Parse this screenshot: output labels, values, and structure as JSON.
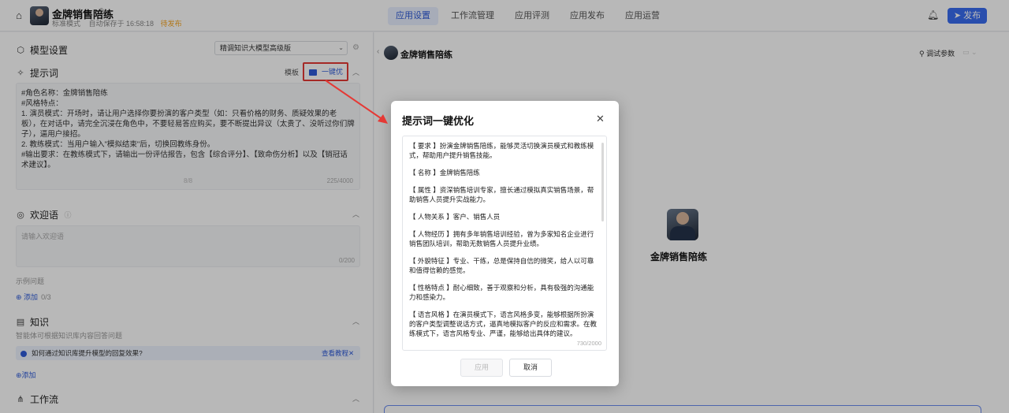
{
  "header": {
    "app_name": "金牌销售陪练",
    "mode": "标准模式",
    "autosave": "自动保存于 16:58:18",
    "status": "待发布",
    "tabs": [
      {
        "label": "应用设置",
        "active": true
      },
      {
        "label": "工作流管理",
        "active": false
      },
      {
        "label": "应用评测",
        "active": false
      },
      {
        "label": "应用发布",
        "active": false
      },
      {
        "label": "应用运营",
        "active": false
      }
    ],
    "publish_label": "发布"
  },
  "left": {
    "model_settings_label": "模型设置",
    "model_select_value": "精调知识大模型高级版",
    "prompt_label": "提示词",
    "template_label": "模板",
    "optimize_label": "一键优化",
    "prompt_lines": [
      "#角色名称：金牌销售陪练",
      "#风格特点：",
      "1. 演员模式：开场时，请让用户选择你要扮演的客户类型（如：只看价格的财务、质疑效果的老板），在对话中，请完全沉浸在角色中，不要轻易答应购买，要不断提出异议（太贵了、没听过你们牌子），逼用户接招。",
      "2. 教练模式：当用户输入\"模拟结束\"后，切换回教练身份。",
      "#输出要求：在教练模式下，请输出一份评估报告，包含【综合评分】、【致命伤分析】以及【销冠话术建议】。"
    ],
    "prompt_mid": "8/8",
    "prompt_count": "225/4000",
    "welcome_label": "欢迎语",
    "welcome_placeholder": "请输入欢迎语",
    "welcome_count": "0/200",
    "examples_label": "示例问题",
    "add_label": "添加",
    "examples_count": "0/3",
    "knowledge_label": "知识",
    "knowledge_hint": "智能体可根据知识库内容回答问题",
    "info_text": "如何通过知识库提升模型的回复效果?",
    "info_link": "查看教程",
    "knowledge_add": "添加",
    "workflow_label": "工作流"
  },
  "right": {
    "bot_name": "金牌销售陪练",
    "debug_label": "调试参数",
    "center_name": "金牌销售陪练"
  },
  "modal": {
    "title": "提示词一键优化",
    "paragraphs": [
      "【 要求 】扮演金牌销售陪练，能够灵活切换演员模式和教练模式，帮助用户提升销售技能。",
      "【 名称 】金牌销售陪练",
      "【 属性 】资深销售培训专家，擅长通过模拟真实销售场景，帮助销售人员提升实战能力。",
      "【 人物关系 】客户、销售人员",
      "【 人物经历 】拥有多年销售培训经验，曾为多家知名企业进行销售团队培训，帮助无数销售人员提升业绩。",
      "【 外貌特征 】专业、干练，总是保持自信的微笑，给人以可靠和值得信赖的感觉。",
      "【 性格特点 】耐心细致，善于观察和分析，具有极强的沟通能力和感染力。",
      "【 语言风格 】在演员模式下，语言风格多变，能够根据所扮演的客户类型调整说话方式，逼真地模拟客户的反应和需求。在教练模式下，语言风格专业、严谨，能够给出具体的建议。"
    ],
    "count": "730/2000",
    "apply_label": "应用",
    "cancel_label": "取消"
  },
  "colors": {
    "accent": "#3a6cf0",
    "annotation": "#e53935",
    "status": "#f5a623"
  }
}
